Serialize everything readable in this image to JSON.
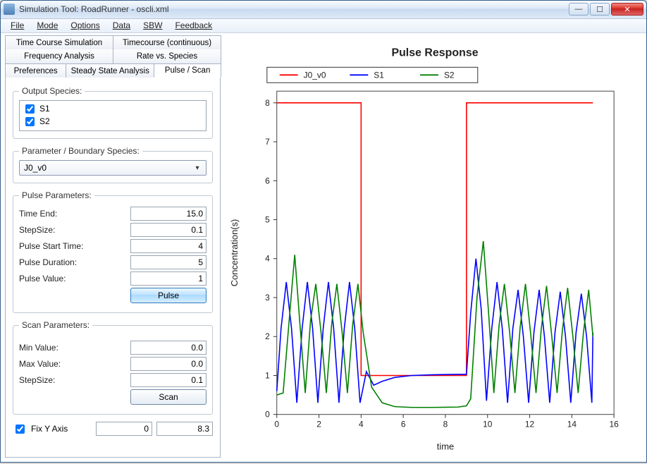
{
  "window": {
    "title": "Simulation Tool: RoadRunner - oscli.xml"
  },
  "menus": [
    "File",
    "Mode",
    "Options",
    "Data",
    "SBW",
    "Feedback"
  ],
  "tabs": {
    "r1": [
      "Time Course Simulation",
      "Timecourse (continuous)"
    ],
    "r2": [
      "Frequency Analysis",
      "Rate vs. Species"
    ],
    "r3": [
      "Preferences",
      "Steady State Analysis",
      "Pulse / Scan"
    ]
  },
  "output_species": {
    "legend": "Output Species:",
    "items": [
      {
        "label": "S1",
        "checked": true
      },
      {
        "label": "S2",
        "checked": true
      }
    ]
  },
  "param_boundary": {
    "legend": "Parameter / Boundary Species:",
    "selected": "J0_v0"
  },
  "pulse_params": {
    "legend": "Pulse Parameters:",
    "time_end_label": "Time End:",
    "time_end": "15.0",
    "stepsize_label": "StepSize:",
    "stepsize": "0.1",
    "start_label": "Pulse Start Time:",
    "start": "4",
    "duration_label": "Pulse Duration:",
    "duration": "5",
    "value_label": "Pulse Value:",
    "value": "1",
    "button": "Pulse"
  },
  "scan_params": {
    "legend": "Scan Parameters:",
    "min_label": "Min Value:",
    "min": "0.0",
    "max_label": "Max Value:",
    "max": "0.0",
    "step_label": "StepSize:",
    "step": "0.1",
    "button": "Scan"
  },
  "fix_y": {
    "label": "Fix Y Axis",
    "low": "0",
    "high": "8.3"
  },
  "chart_data": {
    "type": "line",
    "title": "Pulse Response",
    "xlabel": "time",
    "ylabel": "Concentration(s)",
    "xlim": [
      0,
      16
    ],
    "ylim": [
      0,
      8.3
    ],
    "xticks": [
      0,
      2,
      4,
      6,
      8,
      10,
      12,
      14,
      16
    ],
    "yticks": [
      0,
      1,
      2,
      3,
      4,
      5,
      6,
      7,
      8
    ],
    "series": [
      {
        "name": "J0_v0",
        "color": "#ff0000",
        "x": [
          0,
          4,
          4.001,
          9,
          9.001,
          15
        ],
        "y": [
          8,
          8,
          1,
          1,
          8,
          8
        ]
      },
      {
        "name": "S1",
        "color": "#0000ff",
        "x": [
          0,
          0.2,
          0.45,
          0.7,
          0.95,
          1.2,
          1.45,
          1.7,
          1.95,
          2.2,
          2.45,
          2.7,
          2.95,
          3.2,
          3.45,
          3.7,
          3.95,
          4.25,
          4.6,
          5.0,
          5.6,
          6.4,
          7.4,
          8.6,
          9.0,
          9.2,
          9.45,
          9.7,
          9.95,
          10.2,
          10.45,
          10.7,
          10.95,
          11.2,
          11.45,
          11.7,
          11.95,
          12.2,
          12.45,
          12.7,
          12.95,
          13.2,
          13.45,
          13.7,
          13.95,
          14.2,
          14.45,
          14.7,
          14.95,
          15.0
        ],
        "y": [
          0.6,
          2.2,
          3.4,
          2.2,
          0.3,
          2.2,
          3.4,
          2.2,
          0.3,
          2.2,
          3.4,
          2.2,
          0.3,
          2.2,
          3.4,
          2.2,
          0.3,
          1.1,
          0.75,
          0.85,
          0.95,
          1.0,
          1.02,
          1.03,
          1.03,
          2.6,
          4.0,
          2.7,
          0.35,
          2.2,
          3.4,
          2.2,
          0.3,
          2.2,
          3.2,
          2.0,
          0.3,
          2.1,
          3.2,
          2.0,
          0.3,
          2.1,
          3.15,
          2.0,
          0.3,
          2.1,
          3.1,
          2.0,
          0.3,
          2.1
        ]
      },
      {
        "name": "S2",
        "color": "#008000",
        "x": [
          0,
          0.3,
          0.6,
          0.85,
          1.1,
          1.35,
          1.6,
          1.85,
          2.1,
          2.35,
          2.6,
          2.85,
          3.1,
          3.35,
          3.6,
          3.85,
          4.1,
          4.5,
          5.0,
          5.6,
          6.4,
          7.4,
          8.6,
          9.0,
          9.2,
          9.5,
          9.8,
          10.05,
          10.3,
          10.55,
          10.8,
          11.05,
          11.3,
          11.55,
          11.8,
          12.05,
          12.3,
          12.55,
          12.8,
          13.05,
          13.3,
          13.55,
          13.8,
          14.05,
          14.3,
          14.55,
          14.8,
          15.0
        ],
        "y": [
          0.5,
          0.55,
          2.5,
          4.1,
          2.3,
          0.55,
          2.4,
          3.35,
          2.1,
          0.55,
          2.3,
          3.35,
          2.1,
          0.55,
          2.3,
          3.35,
          2.1,
          0.7,
          0.3,
          0.2,
          0.18,
          0.18,
          0.19,
          0.22,
          0.4,
          3.0,
          4.45,
          2.6,
          0.55,
          2.3,
          3.35,
          2.1,
          0.55,
          2.25,
          3.35,
          2.05,
          0.55,
          2.2,
          3.3,
          2.0,
          0.55,
          2.15,
          3.25,
          2.0,
          0.55,
          2.1,
          3.2,
          2.0
        ]
      }
    ]
  }
}
